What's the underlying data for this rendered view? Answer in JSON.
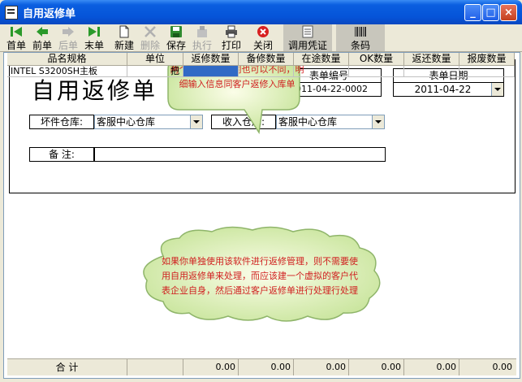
{
  "window": {
    "title": "自用返修单",
    "minimize": "_",
    "maximize": "□",
    "close": "×"
  },
  "toolbar": [
    {
      "label": "首单",
      "icon": "first-record-icon",
      "disabled": false
    },
    {
      "label": "前单",
      "icon": "prev-record-icon",
      "disabled": false
    },
    {
      "label": "后单",
      "icon": "next-record-icon",
      "disabled": true
    },
    {
      "label": "末单",
      "icon": "last-record-icon",
      "disabled": false
    },
    {
      "label": "新建",
      "icon": "new-doc-icon",
      "disabled": false
    },
    {
      "label": "删除",
      "icon": "delete-icon",
      "disabled": true
    },
    {
      "label": "保存",
      "icon": "save-icon",
      "disabled": false
    },
    {
      "label": "执行",
      "icon": "execute-icon",
      "disabled": true
    },
    {
      "label": "打印",
      "icon": "printer-icon",
      "disabled": false
    },
    {
      "label": "关闭",
      "icon": "close-circle-icon",
      "disabled": false
    },
    {
      "label": "调用凭证",
      "icon": "voucher-icon",
      "disabled": false
    },
    {
      "label": "条码",
      "icon": "barcode-icon",
      "disabled": false
    }
  ],
  "form": {
    "title": "自用返修单",
    "doc_no_label": "表单编号",
    "doc_no": "2011-04-22-0002",
    "doc_date_label": "表单日期",
    "doc_date": "2011-04-22",
    "bad_wh_label": "坏件仓库:",
    "bad_wh_value": "客服中心仓库",
    "in_wh_label": "收入仓库:",
    "in_wh_value": "客服中心仓库",
    "remark_label": "备    注:",
    "remark_value": ""
  },
  "callout_top": {
    "text": "两个仓库可以相同也可以不同，明细输入信息同客户返修入库单"
  },
  "callout_center": {
    "text": "如果你单独使用该软件进行返修管理，则不需要使用自用返修单来处理，而应该建一个虚拟的客户代表企业自身，然后通过客户返修单进行处理行处理"
  },
  "table": {
    "columns": [
      "品名规格",
      "单位",
      "返修数量",
      "备修数量",
      "在途数量",
      "OK数量",
      "返还数量",
      "报废数量"
    ],
    "rows": [
      {
        "name": "INTEL  S3200SH主板",
        "unit": "把",
        "cells": [
          "",
          "",
          "",
          "",
          "",
          ""
        ]
      }
    ],
    "footer": {
      "label": "合  计",
      "values": [
        "0.00",
        "0.00",
        "0.00",
        "0.00",
        "0.00",
        "0.00"
      ]
    }
  }
}
